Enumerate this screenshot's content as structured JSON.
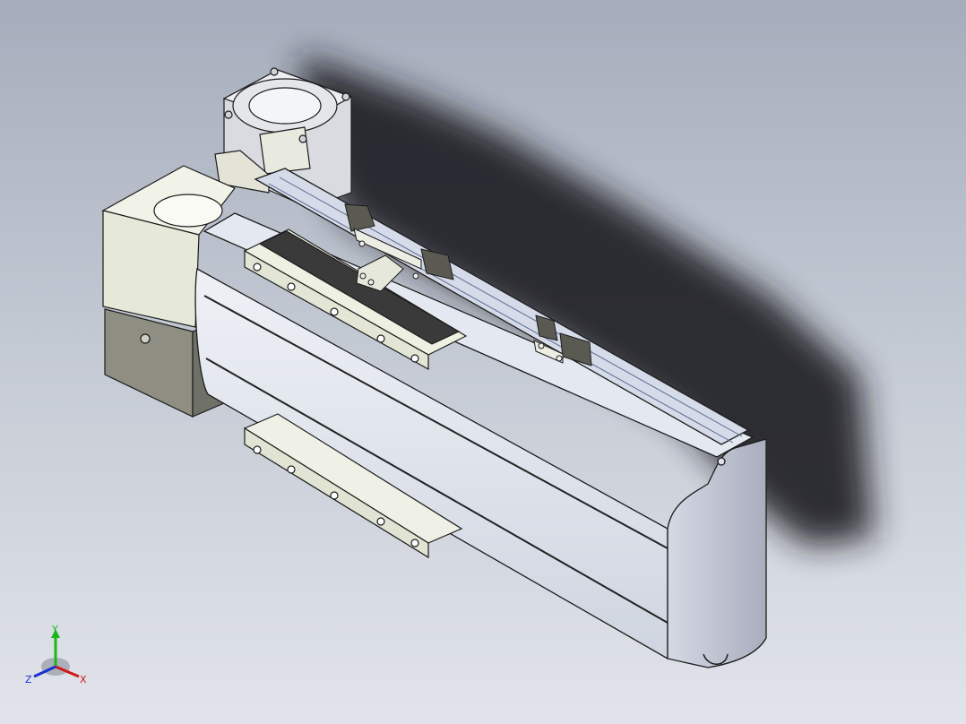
{
  "viewport": {
    "background_top": "#a5adbc",
    "background_bottom": "#e1e4ea",
    "model": {
      "body_color": "#dde2ec",
      "end_cap_color": "#c5cad8",
      "motor_block_color": "#e6e8d8",
      "bracket_color": "#8e8f82",
      "sensor_color": "#5a5a52",
      "outline_color": "#1c1c1c"
    },
    "triad": {
      "x_label": "X",
      "y_label": "Y",
      "z_label": "Z",
      "x_color": "#d01818",
      "y_color": "#18b818",
      "z_color": "#1830d0"
    }
  }
}
